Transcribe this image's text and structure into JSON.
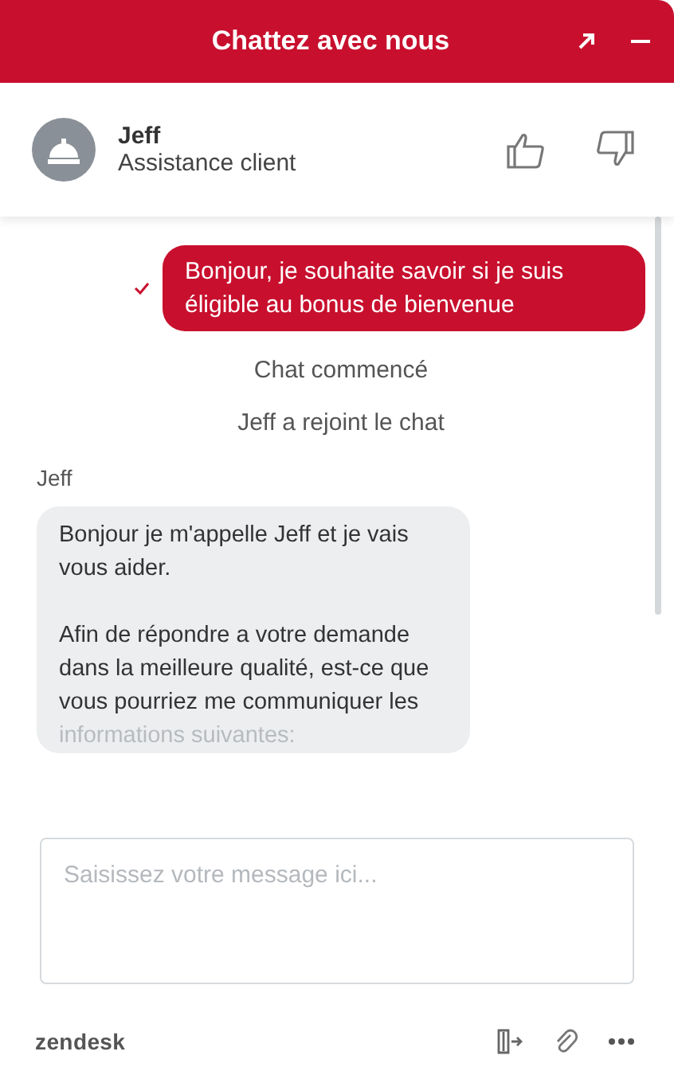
{
  "header": {
    "title": "Chattez avec nous"
  },
  "agent": {
    "name": "Jeff",
    "role": "Assistance client"
  },
  "messages": [
    {
      "kind": "visitor",
      "delivered": true,
      "text": "Bonjour, je souhaite savoir si je suis éligible au bonus de bienvenue"
    },
    {
      "kind": "system",
      "text": "Chat commencé"
    },
    {
      "kind": "system",
      "text": "Jeff a rejoint le chat"
    },
    {
      "kind": "author",
      "text": "Jeff"
    },
    {
      "kind": "agent",
      "paragraphs": [
        "Bonjour je m'appelle Jeff et je vais vous aider.",
        "Afin de répondre a votre demande dans la meilleure qualité, est-ce que vous pourriez me communiquer les"
      ],
      "faded_line": "informations suivantes:"
    }
  ],
  "composer": {
    "placeholder": "Saisissez votre message ici..."
  },
  "footer": {
    "brand": "zendesk"
  }
}
